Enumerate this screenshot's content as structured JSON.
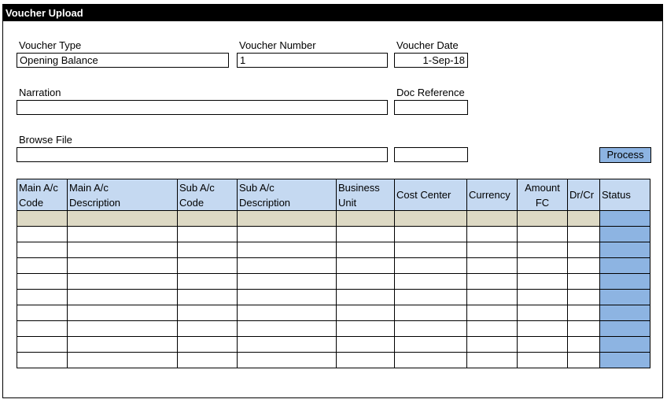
{
  "window": {
    "title": "Voucher Upload"
  },
  "form": {
    "voucher_type": {
      "label": "Voucher Type",
      "value": "Opening Balance"
    },
    "voucher_number": {
      "label": "Voucher Number",
      "value": "1"
    },
    "voucher_date": {
      "label": "Voucher Date",
      "value": "1-Sep-18"
    },
    "narration": {
      "label": "Narration",
      "value": ""
    },
    "doc_reference": {
      "label": "Doc Reference",
      "value": ""
    },
    "browse_file": {
      "label": "Browse File",
      "value": "",
      "extra_value": ""
    },
    "process_button": "Process"
  },
  "table": {
    "columns": [
      {
        "line1": "Main A/c",
        "line2": "Code"
      },
      {
        "line1": "Main A/c",
        "line2": "Description"
      },
      {
        "line1": "Sub A/c",
        "line2": "Code"
      },
      {
        "line1": "Sub A/c",
        "line2": "Description"
      },
      {
        "line1": "Business",
        "line2": "Unit"
      },
      {
        "line1": "Cost Center",
        "line2": ""
      },
      {
        "line1": "Currency",
        "line2": ""
      },
      {
        "line1": "Amount",
        "line2": "FC"
      },
      {
        "line1": "Dr/Cr",
        "line2": ""
      },
      {
        "line1": "Status",
        "line2": ""
      }
    ],
    "rows": [
      [
        "",
        "",
        "",
        "",
        "",
        "",
        "",
        "",
        "",
        ""
      ],
      [
        "",
        "",
        "",
        "",
        "",
        "",
        "",
        "",
        "",
        ""
      ],
      [
        "",
        "",
        "",
        "",
        "",
        "",
        "",
        "",
        "",
        ""
      ],
      [
        "",
        "",
        "",
        "",
        "",
        "",
        "",
        "",
        "",
        ""
      ],
      [
        "",
        "",
        "",
        "",
        "",
        "",
        "",
        "",
        "",
        ""
      ],
      [
        "",
        "",
        "",
        "",
        "",
        "",
        "",
        "",
        "",
        ""
      ],
      [
        "",
        "",
        "",
        "",
        "",
        "",
        "",
        "",
        "",
        ""
      ],
      [
        "",
        "",
        "",
        "",
        "",
        "",
        "",
        "",
        "",
        ""
      ],
      [
        "",
        "",
        "",
        "",
        "",
        "",
        "",
        "",
        "",
        ""
      ],
      [
        "",
        "",
        "",
        "",
        "",
        "",
        "",
        "",
        "",
        ""
      ]
    ]
  },
  "colors": {
    "title_bar": "#000000",
    "header_fill": "#c5d9f1",
    "status_fill": "#8db4e2",
    "selected_row_fill": "#ddd9c4",
    "button_fill": "#8db4e2"
  }
}
